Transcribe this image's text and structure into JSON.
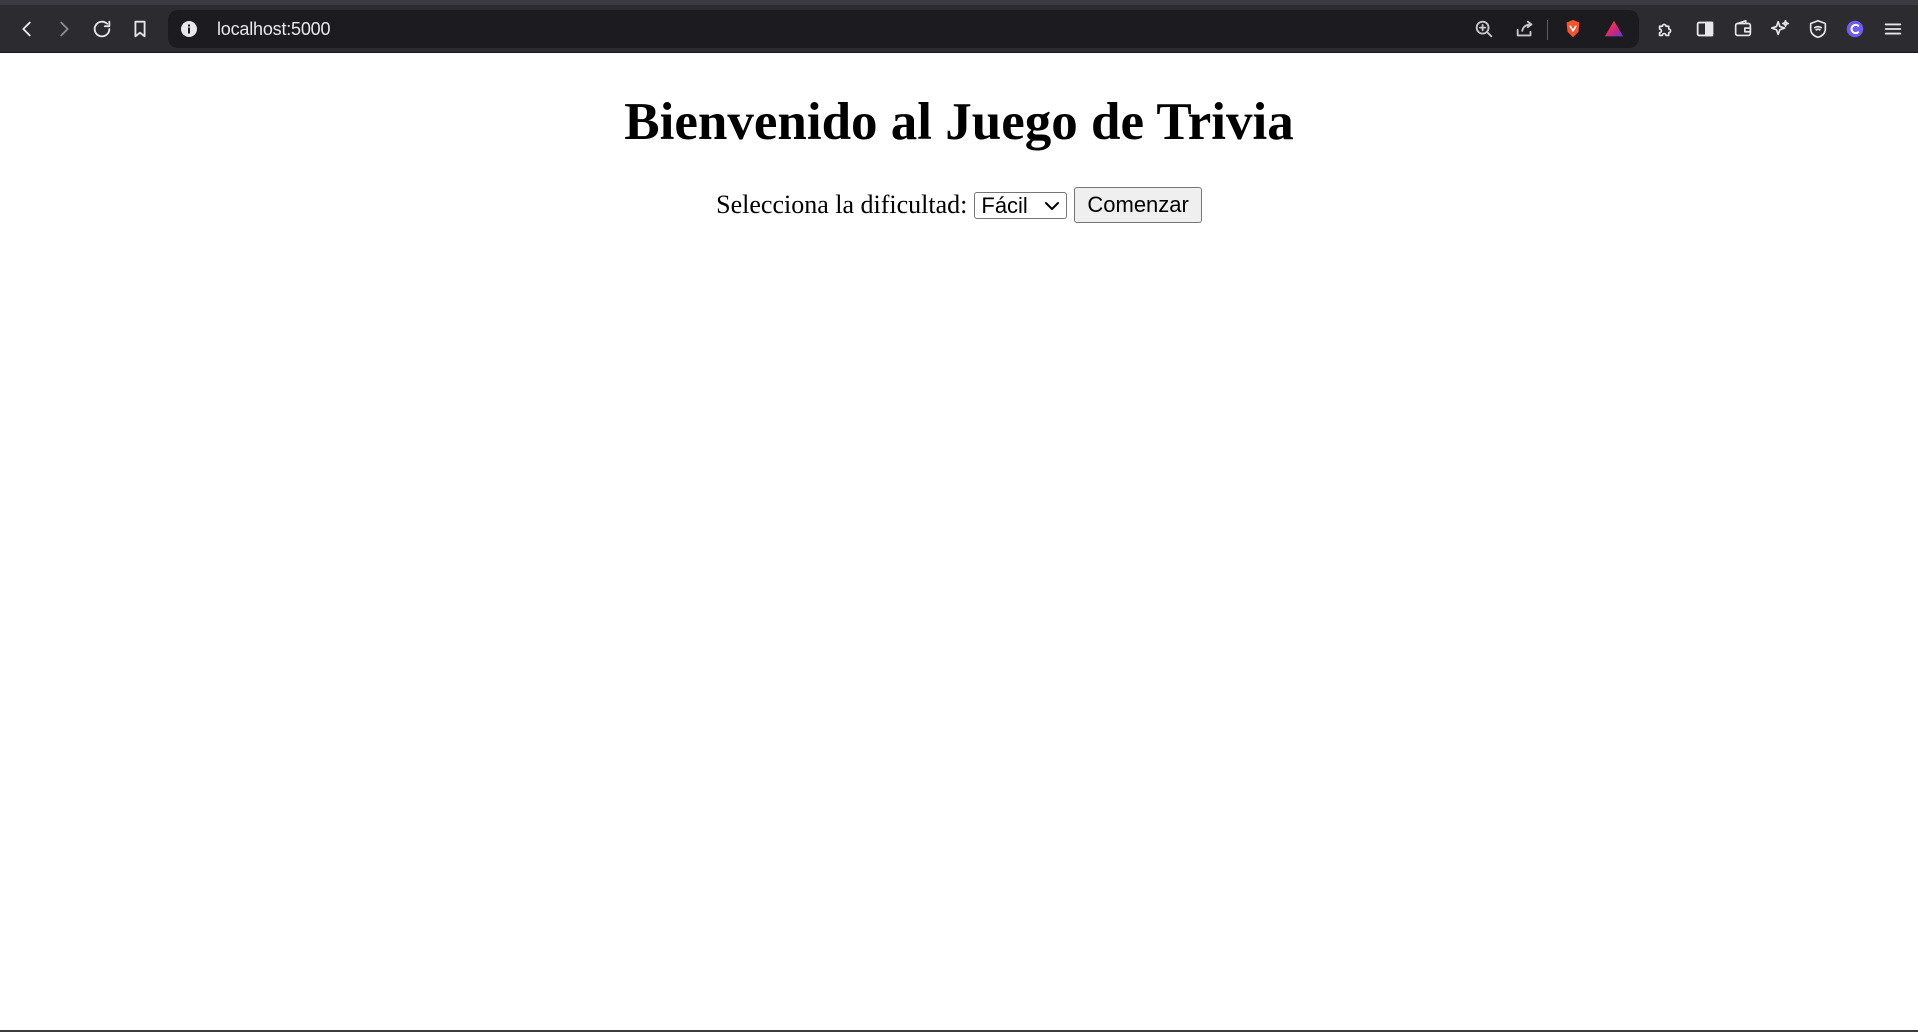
{
  "browser": {
    "url": "localhost:5000"
  },
  "page": {
    "title": "Bienvenido al Juego de Trivia",
    "difficulty_label": "Selecciona la dificultad:",
    "difficulty_selected": "Fácil",
    "start_button": "Comenzar"
  },
  "icons": {
    "nav": [
      "back-icon",
      "forward-icon",
      "reload-icon",
      "bookmark-icon"
    ],
    "urlbar": [
      "info-icon",
      "zoom-icon",
      "share-icon",
      "brave-shields-icon",
      "brave-rewards-icon"
    ],
    "toolbar": [
      "extensions-icon",
      "sidebar-icon",
      "wallet-icon",
      "leo-ai-icon",
      "vpn-icon",
      "profile-icon",
      "menu-icon"
    ]
  },
  "colors": {
    "chrome_bg": "#2b2b30",
    "urlbar_bg": "#1c1c20",
    "brave_orange": "#fb542b",
    "page_bg": "#ffffff"
  }
}
